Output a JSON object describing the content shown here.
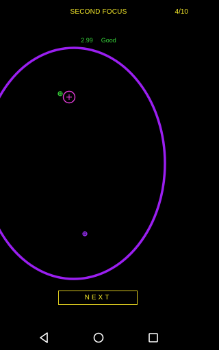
{
  "game": {
    "title": "SECOND FOCUS",
    "progress": "4/10"
  },
  "score": {
    "value": "2.99",
    "rating": "Good"
  },
  "colors": {
    "ellipse": "#9a1ff0",
    "marker_true": "#37d43a",
    "marker_guess": "#e23cd8",
    "first_focus": "#a030ff",
    "text_yellow": "#f2e62a",
    "text_green": "#37d43a"
  },
  "actions": {
    "next_label": "NEXT"
  },
  "navigation": {
    "back_icon": "triangle-back-icon",
    "home_icon": "circle-home-icon",
    "recents_icon": "square-recents-icon"
  }
}
